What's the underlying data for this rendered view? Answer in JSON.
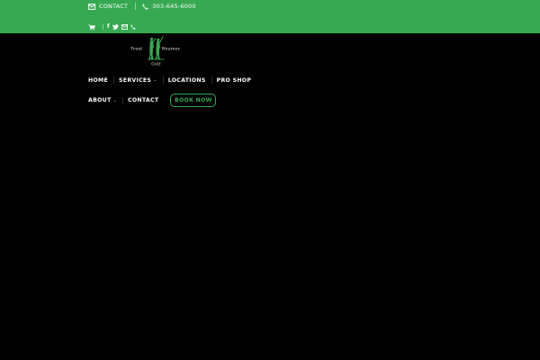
{
  "colors": {
    "accent": "#36a852",
    "background": "#000000",
    "text": "#ffffff"
  },
  "topbar": {
    "contact_label": "CONTACT",
    "phone": "303-645-6000",
    "icons": [
      "envelope-icon",
      "phone-icon",
      "cart-icon",
      "facebook-icon",
      "twitter-icon",
      "email-icon",
      "phone-icon"
    ]
  },
  "logo": {
    "text_left": "Trent",
    "text_right": "Wearner",
    "text_bottom": "Golf"
  },
  "nav": {
    "home": "HOME",
    "services": "SERVICES",
    "locations": "LOCATIONS",
    "pro_shop": "PRO SHOP",
    "about": "ABOUT",
    "contact": "CONTACT",
    "book_now": "BOOK NOW"
  }
}
